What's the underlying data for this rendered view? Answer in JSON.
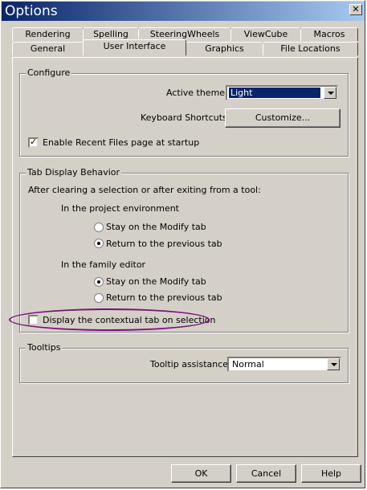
{
  "window": {
    "title": "Options",
    "close_label": "✕"
  },
  "tabs": {
    "row1": [
      "Rendering",
      "Spelling",
      "SteeringWheels",
      "ViewCube",
      "Macros"
    ],
    "row2": [
      "General",
      "User Interface",
      "Graphics",
      "File Locations"
    ],
    "active": "User Interface"
  },
  "configure": {
    "title": "Configure",
    "active_theme_label": "Active theme:",
    "active_theme_value": "Light",
    "shortcuts_label": "Keyboard Shortcuts:",
    "customize_label": "Customize...",
    "recent_files_label": "Enable Recent Files page at startup",
    "recent_files_checked": true
  },
  "tab_display": {
    "title": "Tab Display Behavior",
    "intro": "After clearing a selection or after exiting from a tool:",
    "project_heading": "In the project environment",
    "project_stay_label": "Stay on the Modify tab",
    "project_return_label": "Return to the previous tab",
    "project_selected": "return",
    "family_heading": "In the family editor",
    "family_stay_label": "Stay on the Modify tab",
    "family_return_label": "Return to the previous tab",
    "family_selected": "stay",
    "contextual_label": "Display the contextual tab on selection",
    "contextual_checked": false
  },
  "tooltips": {
    "title": "Tooltips",
    "assistance_label": "Tooltip assistance:",
    "assistance_value": "Normal"
  },
  "footer": {
    "ok_label": "OK",
    "cancel_label": "Cancel",
    "help_label": "Help"
  },
  "colors": {
    "title_gradient_start": "#0a246a",
    "title_gradient_end": "#a6caf0",
    "annotation_ellipse": "#7a0f7a",
    "dialog_bg": "#d4d0c8"
  }
}
